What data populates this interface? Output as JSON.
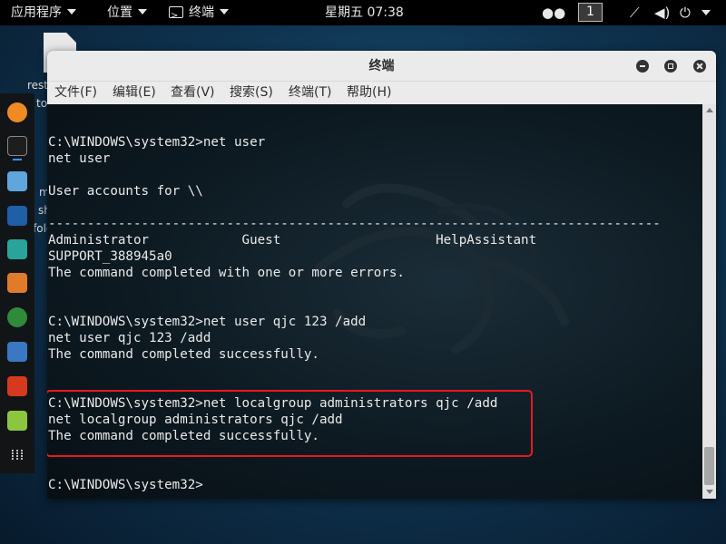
{
  "topbar": {
    "applications": "应用程序",
    "places": "位置",
    "terminal_app": "终端",
    "clock": "星期五 07:38",
    "workspace": "1"
  },
  "desktop": {
    "file_label_1": "rest",
    "file_label_2": "tools.sh",
    "folder_label_1": "m",
    "folder_label_2": "shared-",
    "folder_label_3": "fold..."
  },
  "window": {
    "title": "终端",
    "menu": [
      "文件(F)",
      "编辑(E)",
      "查看(V)",
      "搜索(S)",
      "终端(T)",
      "帮助(H)"
    ]
  },
  "terminal": {
    "lines": [
      "C:\\WINDOWS\\system32>net user",
      "net user",
      "",
      "User accounts for \\\\",
      "",
      "-------------------------------------------------------------------------------",
      "Administrator            Guest                    HelpAssistant",
      "SUPPORT_388945a0",
      "The command completed with one or more errors.",
      "",
      "",
      "C:\\WINDOWS\\system32>net user qjc 123 /add",
      "net user qjc 123 /add",
      "The command completed successfully.",
      "",
      "",
      "C:\\WINDOWS\\system32>net localgroup administrators qjc /add",
      "net localgroup administrators qjc /add",
      "The command completed successfully.",
      "",
      "",
      "C:\\WINDOWS\\system32>"
    ]
  },
  "colors": {
    "highlight": "#e8191f",
    "terminal_text": "#eaeaea",
    "dock_indicator": "#3a90ff"
  },
  "icons": {
    "dock": [
      "firefox-icon",
      "terminal-icon",
      "files-icon",
      "metasploit-icon",
      "armitage-icon",
      "burpsuite-icon",
      "maltego-icon",
      "beef-icon",
      "faraday-icon",
      "leafpad-icon",
      "show-apps-icon"
    ]
  }
}
